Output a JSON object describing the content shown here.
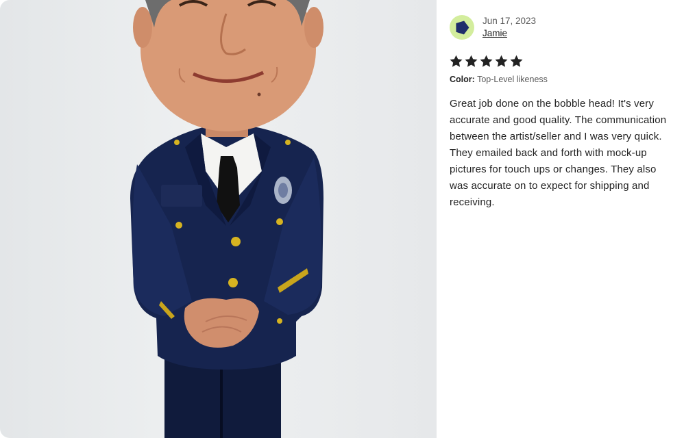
{
  "photo": {
    "subject": "bobblehead-figure"
  },
  "review": {
    "date": "Jun 17, 2023",
    "reviewer": "Jamie",
    "rating": 5,
    "rating_max": 5,
    "variation_label": "Color:",
    "variation_value": "Top-Level likeness",
    "text": "Great job done on the bobble head! It's very accurate and good quality. The communication between the artist/seller and I was very quick. They emailed back and forth with mock-up pictures for touch ups or changes. They also was accurate on to expect for shipping and receiving."
  },
  "colors": {
    "avatar_bg": "#d3ed9d",
    "avatar_shape": "#1f2d6b",
    "star": "#222222",
    "text": "#222222",
    "muted": "#595959"
  },
  "icons": {
    "avatar": "pentagon-avatar-icon",
    "star": "star-icon"
  }
}
